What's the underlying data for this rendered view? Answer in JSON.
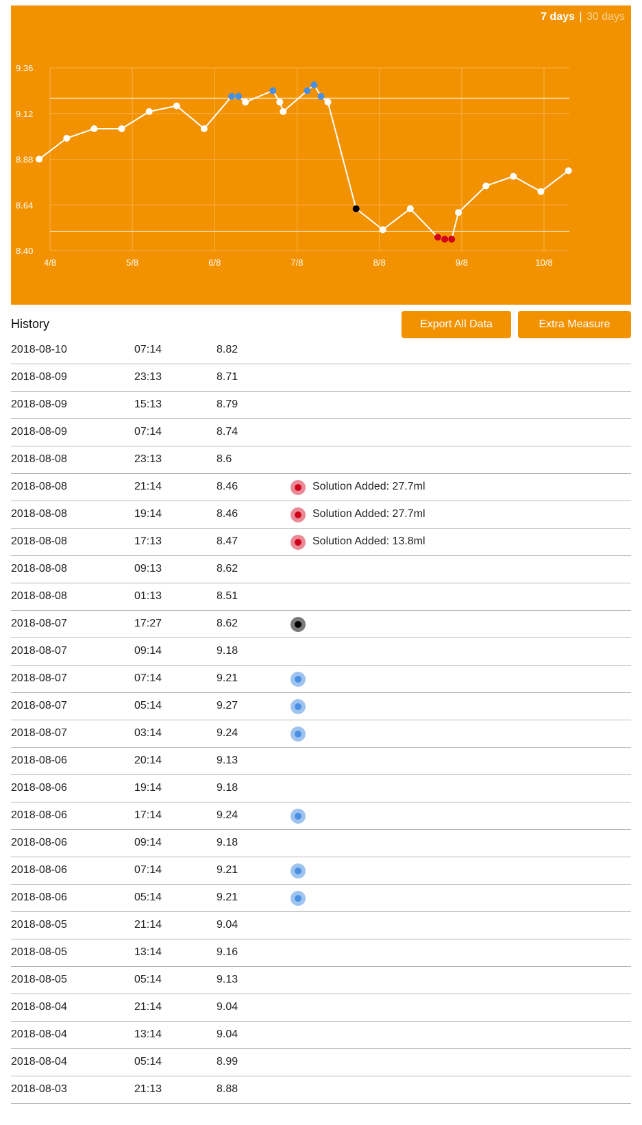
{
  "range_toggle": {
    "active": "7 days",
    "separator": "|",
    "inactive": "30 days"
  },
  "colors": {
    "panel": "#f39200",
    "line": "#ffffff",
    "marker_blue": "#4a90e2",
    "marker_red": "#d0021b",
    "marker_black": "#000000"
  },
  "chart_data": {
    "type": "line",
    "title": "",
    "xlabel": "",
    "ylabel": "",
    "y_ticks": [
      "9.36",
      "9.12",
      "8.88",
      "8.64",
      "8.40"
    ],
    "x_ticks": [
      "4/8",
      "5/8",
      "6/8",
      "7/8",
      "8/8",
      "9/8",
      "10/8"
    ],
    "ylim": [
      8.4,
      9.36
    ],
    "threshold_lines": [
      9.2,
      8.5
    ],
    "grid": true,
    "series": [
      {
        "points": [
          {
            "x": "2018-08-03 21:13",
            "y": 8.88,
            "marker": "white"
          },
          {
            "x": "2018-08-04 05:14",
            "y": 8.99,
            "marker": "white"
          },
          {
            "x": "2018-08-04 13:14",
            "y": 9.04,
            "marker": "white"
          },
          {
            "x": "2018-08-04 21:14",
            "y": 9.04,
            "marker": "white"
          },
          {
            "x": "2018-08-05 05:14",
            "y": 9.13,
            "marker": "white"
          },
          {
            "x": "2018-08-05 13:14",
            "y": 9.16,
            "marker": "white"
          },
          {
            "x": "2018-08-05 21:14",
            "y": 9.04,
            "marker": "white"
          },
          {
            "x": "2018-08-06 05:14",
            "y": 9.21,
            "marker": "blue"
          },
          {
            "x": "2018-08-06 07:14",
            "y": 9.21,
            "marker": "blue"
          },
          {
            "x": "2018-08-06 09:14",
            "y": 9.18,
            "marker": "white"
          },
          {
            "x": "2018-08-06 17:14",
            "y": 9.24,
            "marker": "blue"
          },
          {
            "x": "2018-08-06 19:14",
            "y": 9.18,
            "marker": "white"
          },
          {
            "x": "2018-08-06 20:14",
            "y": 9.13,
            "marker": "white"
          },
          {
            "x": "2018-08-07 03:14",
            "y": 9.24,
            "marker": "blue"
          },
          {
            "x": "2018-08-07 05:14",
            "y": 9.27,
            "marker": "blue"
          },
          {
            "x": "2018-08-07 07:14",
            "y": 9.21,
            "marker": "blue"
          },
          {
            "x": "2018-08-07 09:14",
            "y": 9.18,
            "marker": "white"
          },
          {
            "x": "2018-08-07 17:27",
            "y": 8.62,
            "marker": "black"
          },
          {
            "x": "2018-08-08 01:13",
            "y": 8.51,
            "marker": "white"
          },
          {
            "x": "2018-08-08 09:13",
            "y": 8.62,
            "marker": "white"
          },
          {
            "x": "2018-08-08 17:13",
            "y": 8.47,
            "marker": "red"
          },
          {
            "x": "2018-08-08 19:14",
            "y": 8.46,
            "marker": "red"
          },
          {
            "x": "2018-08-08 21:14",
            "y": 8.46,
            "marker": "red"
          },
          {
            "x": "2018-08-08 23:13",
            "y": 8.6,
            "marker": "white"
          },
          {
            "x": "2018-08-09 07:14",
            "y": 8.74,
            "marker": "white"
          },
          {
            "x": "2018-08-09 15:13",
            "y": 8.79,
            "marker": "white"
          },
          {
            "x": "2018-08-09 23:13",
            "y": 8.71,
            "marker": "white"
          },
          {
            "x": "2018-08-10 07:14",
            "y": 8.82,
            "marker": "white"
          }
        ]
      }
    ]
  },
  "history": {
    "title": "History",
    "export_label": "Export All Data",
    "extra_label": "Extra Measure",
    "rows": [
      {
        "date": "2018-08-10",
        "time": "07:14",
        "value": "8.82",
        "marker": "",
        "note": ""
      },
      {
        "date": "2018-08-09",
        "time": "23:13",
        "value": "8.71",
        "marker": "",
        "note": ""
      },
      {
        "date": "2018-08-09",
        "time": "15:13",
        "value": "8.79",
        "marker": "",
        "note": ""
      },
      {
        "date": "2018-08-09",
        "time": "07:14",
        "value": "8.74",
        "marker": "",
        "note": ""
      },
      {
        "date": "2018-08-08",
        "time": "23:13",
        "value": "8.6",
        "marker": "",
        "note": ""
      },
      {
        "date": "2018-08-08",
        "time": "21:14",
        "value": "8.46",
        "marker": "red",
        "note": "Solution Added: 27.7ml"
      },
      {
        "date": "2018-08-08",
        "time": "19:14",
        "value": "8.46",
        "marker": "red",
        "note": "Solution Added: 27.7ml"
      },
      {
        "date": "2018-08-08",
        "time": "17:13",
        "value": "8.47",
        "marker": "red",
        "note": "Solution Added: 13.8ml"
      },
      {
        "date": "2018-08-08",
        "time": "09:13",
        "value": "8.62",
        "marker": "",
        "note": ""
      },
      {
        "date": "2018-08-08",
        "time": "01:13",
        "value": "8.51",
        "marker": "",
        "note": ""
      },
      {
        "date": "2018-08-07",
        "time": "17:27",
        "value": "8.62",
        "marker": "black",
        "note": ""
      },
      {
        "date": "2018-08-07",
        "time": "09:14",
        "value": "9.18",
        "marker": "",
        "note": ""
      },
      {
        "date": "2018-08-07",
        "time": "07:14",
        "value": "9.21",
        "marker": "blue",
        "note": ""
      },
      {
        "date": "2018-08-07",
        "time": "05:14",
        "value": "9.27",
        "marker": "blue",
        "note": ""
      },
      {
        "date": "2018-08-07",
        "time": "03:14",
        "value": "9.24",
        "marker": "blue",
        "note": ""
      },
      {
        "date": "2018-08-06",
        "time": "20:14",
        "value": "9.13",
        "marker": "",
        "note": ""
      },
      {
        "date": "2018-08-06",
        "time": "19:14",
        "value": "9.18",
        "marker": "",
        "note": ""
      },
      {
        "date": "2018-08-06",
        "time": "17:14",
        "value": "9.24",
        "marker": "blue",
        "note": ""
      },
      {
        "date": "2018-08-06",
        "time": "09:14",
        "value": "9.18",
        "marker": "",
        "note": ""
      },
      {
        "date": "2018-08-06",
        "time": "07:14",
        "value": "9.21",
        "marker": "blue",
        "note": ""
      },
      {
        "date": "2018-08-06",
        "time": "05:14",
        "value": "9.21",
        "marker": "blue",
        "note": ""
      },
      {
        "date": "2018-08-05",
        "time": "21:14",
        "value": "9.04",
        "marker": "",
        "note": ""
      },
      {
        "date": "2018-08-05",
        "time": "13:14",
        "value": "9.16",
        "marker": "",
        "note": ""
      },
      {
        "date": "2018-08-05",
        "time": "05:14",
        "value": "9.13",
        "marker": "",
        "note": ""
      },
      {
        "date": "2018-08-04",
        "time": "21:14",
        "value": "9.04",
        "marker": "",
        "note": ""
      },
      {
        "date": "2018-08-04",
        "time": "13:14",
        "value": "9.04",
        "marker": "",
        "note": ""
      },
      {
        "date": "2018-08-04",
        "time": "05:14",
        "value": "8.99",
        "marker": "",
        "note": ""
      },
      {
        "date": "2018-08-03",
        "time": "21:13",
        "value": "8.88",
        "marker": "",
        "note": ""
      }
    ]
  }
}
